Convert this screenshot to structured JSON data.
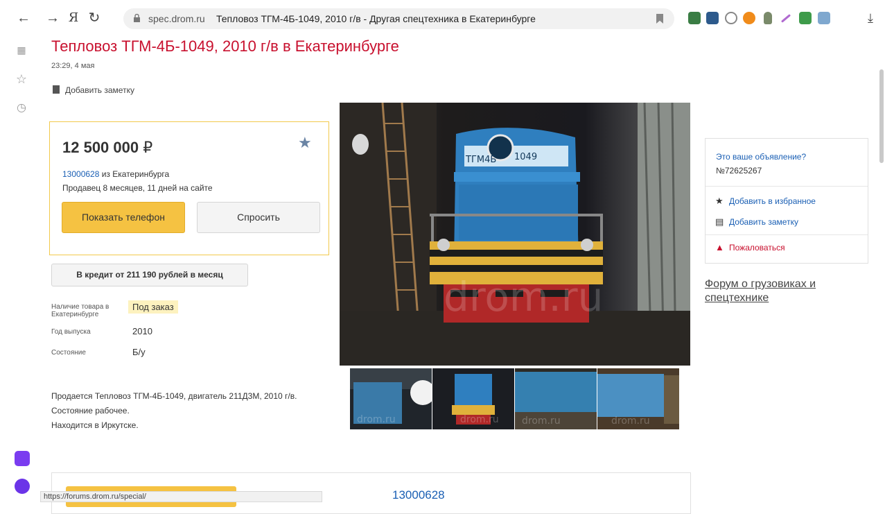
{
  "browser": {
    "domain": "spec.drom.ru",
    "tab_title": "Тепловоз ТГМ-4Б-1049, 2010 г/в - Другая спецтехника в Екатеринбурге",
    "ya_label": "Я",
    "status_url": "https://forums.drom.ru/special/"
  },
  "listing": {
    "title": "Тепловоз ТГМ-4Б-1049, 2010 г/в в Екатеринбурге",
    "date": "23:29, 4 мая",
    "add_note": "Добавить заметку",
    "price": "12 500 000",
    "currency": "₽",
    "seller_id": "13000628",
    "seller_city": " из Екатеринбурга",
    "seller_age": "Продавец 8 месяцев, 11 дней на сайте",
    "btn_phone": "Показать телефон",
    "btn_ask": "Спросить",
    "btn_credit": "В кредит от 211 190 рублей в месяц",
    "specs": {
      "availability_label": "Наличие товара в Екатеринбурге",
      "availability_value": "Под заказ",
      "year_label": "Год выпуска",
      "year_value": "2010",
      "condition_label": "Состояние",
      "condition_value": "Б/у"
    },
    "description": [
      "Продается Тепловоз ТГМ-4Б-1049, двигатель 211Д3М, 2010 г/в.",
      "Состояние рабочее.",
      "Находится в Иркутске."
    ],
    "loco_plate_left": "ТГМ4Б",
    "loco_plate_right": "1049",
    "watermark": "drom.ru",
    "thumb_watermark": "drom.ru"
  },
  "side": {
    "question": "Это ваше объявление?",
    "number": "№72625267",
    "add_fav": "Добавить в избранное",
    "add_note": "Добавить заметку",
    "complain": "Пожаловаться",
    "forum": "Форум о грузовиках и спецтехнике"
  },
  "bottom": {
    "seller_id": "13000628"
  }
}
